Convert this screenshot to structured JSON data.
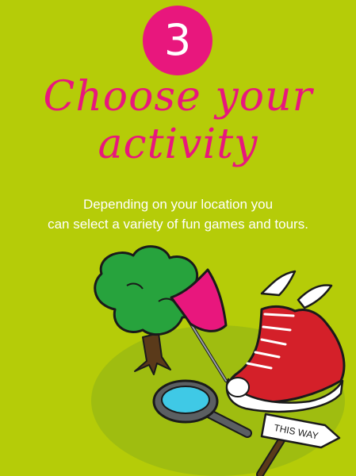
{
  "step": {
    "number": "3"
  },
  "title": {
    "line1": "Choose your",
    "line2": "activity"
  },
  "description": {
    "line1": "Depending on your location you",
    "line2": "can select a variety of fun games and tours."
  },
  "sign": {
    "text": "THIS WAY"
  },
  "colors": {
    "background": "#b5cc08",
    "accent": "#e8177d",
    "ground": "#9fbd10",
    "tree": "#27a33d",
    "trunk": "#5a3a1a",
    "shoe": "#d42029",
    "lens": "#3fc9e6"
  },
  "icons": [
    "tree-icon",
    "flag-icon",
    "winged-sneaker-icon",
    "magnifying-glass-icon",
    "signpost-icon"
  ]
}
